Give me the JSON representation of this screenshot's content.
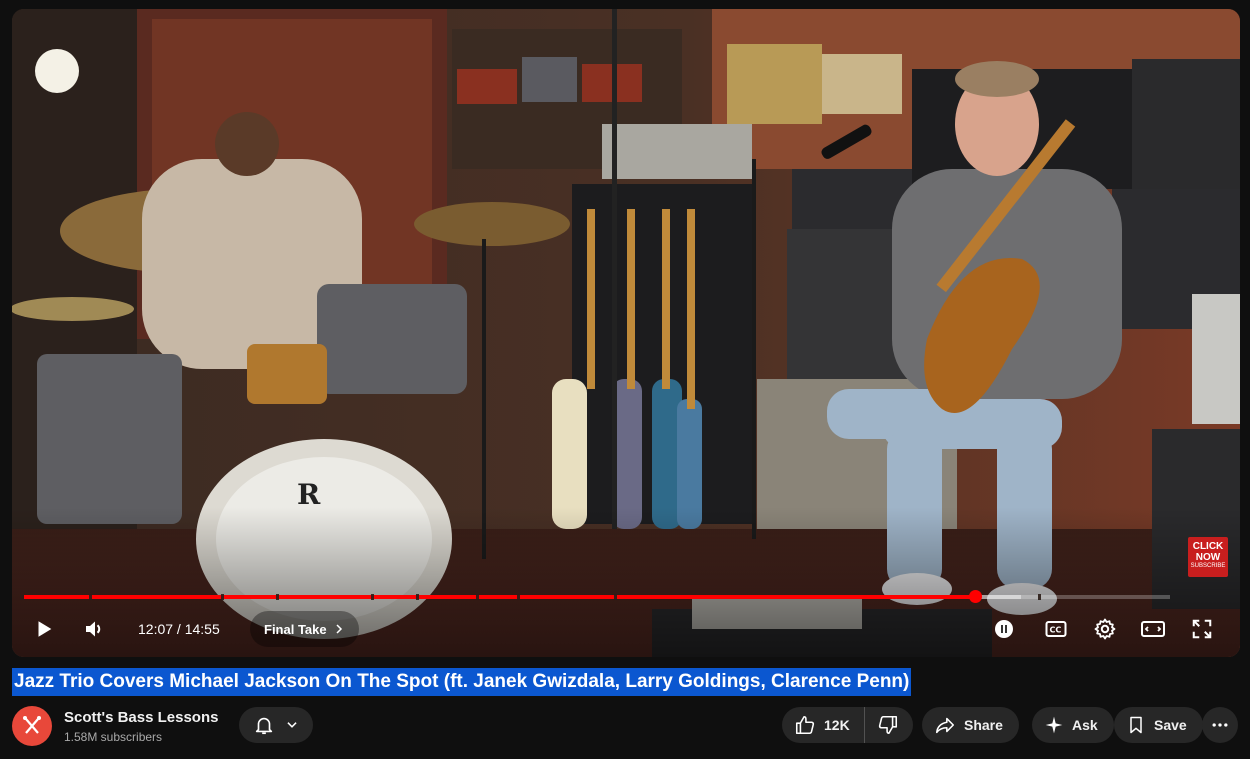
{
  "video": {
    "current_time": "12:07",
    "duration": "14:55",
    "time_separator": " / ",
    "progress": 0.83,
    "buffered": 0.87,
    "chapter_title": "Final Take",
    "watermark_text": "CLICK NOW",
    "watermark_subtext": "SUBSCRIBE",
    "brand_color": "#ff0000"
  },
  "icons": {
    "play": "play-icon",
    "volume": "volume-icon",
    "chevron": "chevron-right-icon",
    "autoplay": "autoplay-toggle-icon",
    "captions": "captions-icon",
    "settings": "gear-icon",
    "theater": "theater-mode-icon",
    "fullscreen": "fullscreen-icon"
  },
  "title": "Jazz Trio Covers Michael Jackson On The Spot (ft. Janek Gwizdala, Larry Goldings, Clarence Penn)",
  "channel": {
    "name": "Scott's Bass Lessons",
    "subscribers": "1.58M subscribers",
    "avatar_color": "#e8483a"
  },
  "actions": {
    "like_count": "12K",
    "share_label": "Share",
    "ask_label": "Ask",
    "save_label": "Save"
  }
}
